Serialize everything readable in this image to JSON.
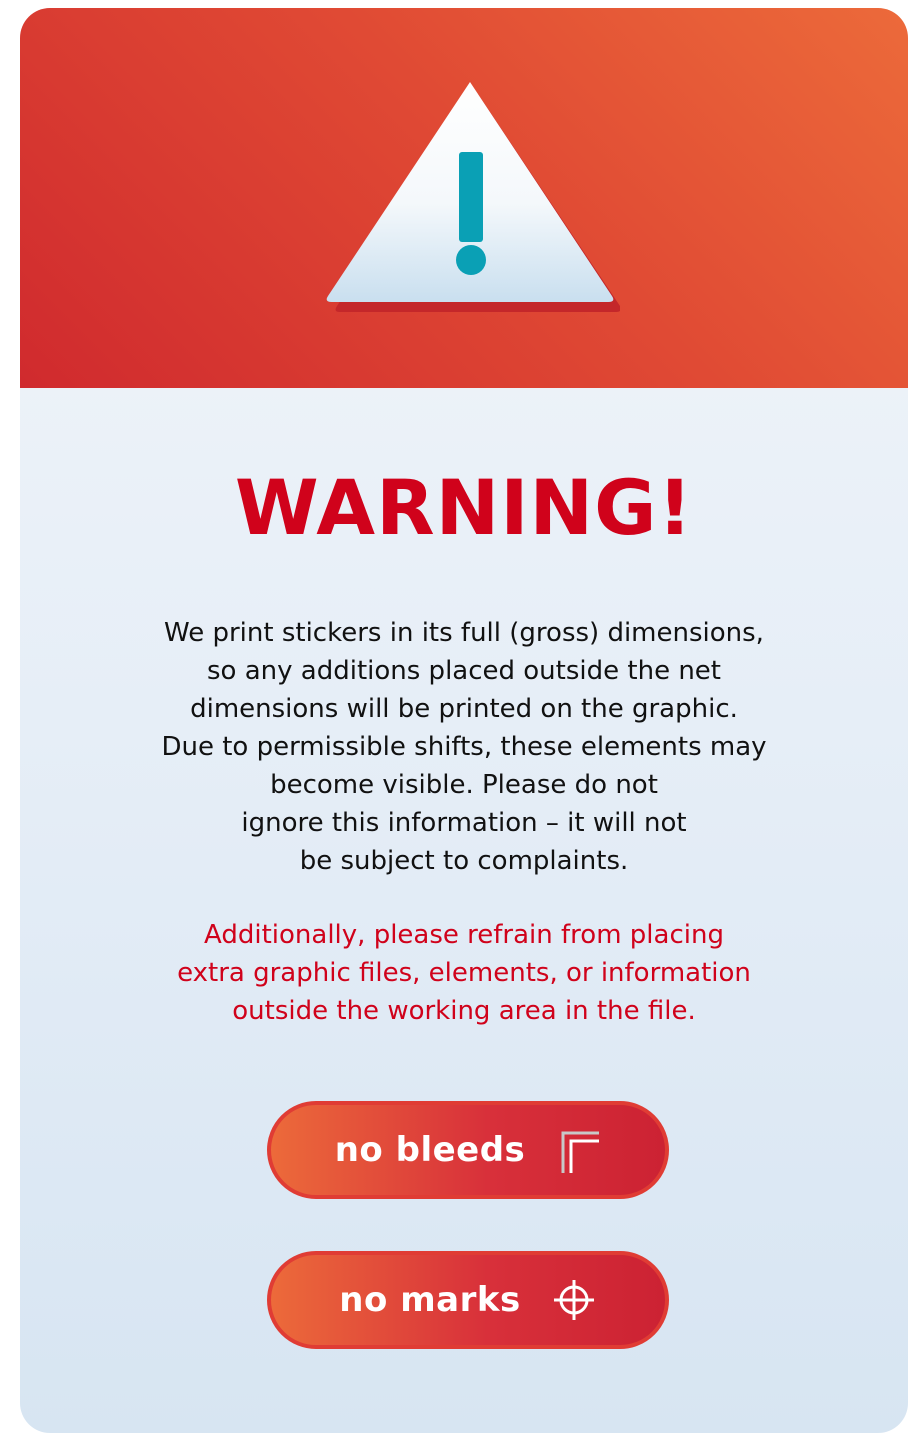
{
  "header": {
    "icon": "warning-triangle-icon",
    "colors": {
      "banner_start": "#ec6a3a",
      "banner_end": "#d02a2e",
      "icon_exclamation": "#0aa0b5"
    }
  },
  "content": {
    "title": "WARNING!",
    "body": "We print stickers in its full (gross) dimensions,\nso any additions placed outside the net\ndimensions will be printed on the graphic.\nDue to permissible shifts, these elements may\nbecome visible. Please do not\nignore this information – it will not\nbe subject to complaints.",
    "note": "Additionally, please refrain from placing\nextra graphic files, elements, or information\noutside the working area in the file.",
    "colors": {
      "title": "#d0021b",
      "note": "#d0021b",
      "body": "#111111"
    }
  },
  "buttons": [
    {
      "label": "no bleeds",
      "icon": "corner-crop-icon"
    },
    {
      "label": "no marks",
      "icon": "crosshair-icon"
    }
  ]
}
